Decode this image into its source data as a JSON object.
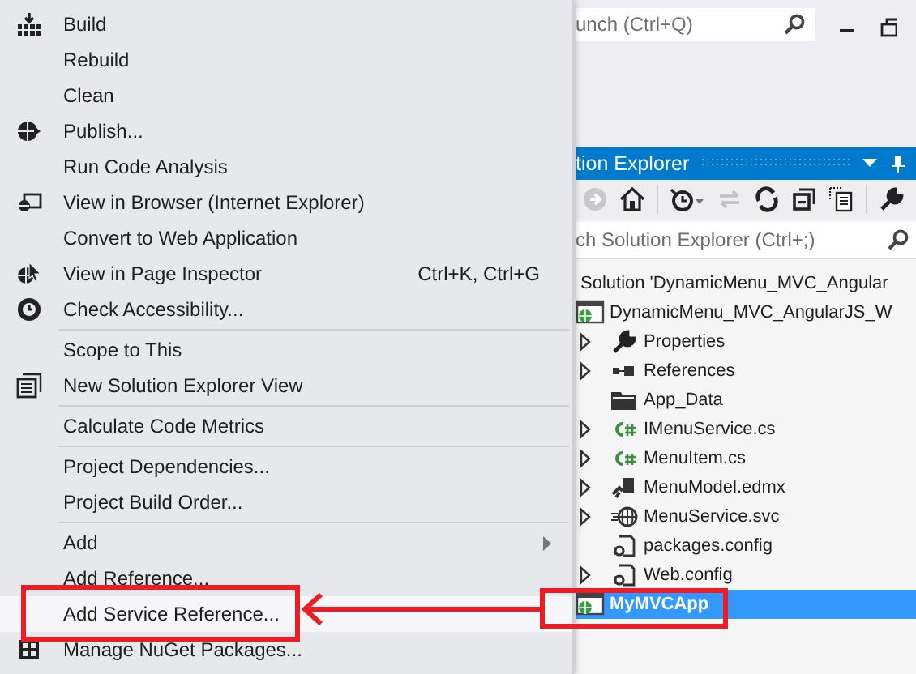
{
  "quick_launch": {
    "value": "unch (Ctrl+Q)"
  },
  "solution_explorer": {
    "title": "tion Explorer",
    "search": {
      "placeholder": "ch Solution Explorer (Ctrl+;)"
    },
    "tree": [
      {
        "label": "Solution 'DynamicMenu_MVC_Angular",
        "selected": false,
        "children": [
          {
            "label": "DynamicMenu_MVC_AngularJS_W",
            "kind": "project",
            "selected": false,
            "children": [
              {
                "label": "Properties",
                "kind": "wrench",
                "expandable": true,
                "selected": false
              },
              {
                "label": "References",
                "kind": "references",
                "expandable": true,
                "selected": false
              },
              {
                "label": "App_Data",
                "kind": "folder",
                "expandable": false,
                "selected": false
              },
              {
                "label": "IMenuService.cs",
                "kind": "csharp",
                "expandable": true,
                "selected": false
              },
              {
                "label": "MenuItem.cs",
                "kind": "csharp",
                "expandable": true,
                "selected": false
              },
              {
                "label": "MenuModel.edmx",
                "kind": "model",
                "expandable": true,
                "selected": false
              },
              {
                "label": "MenuService.svc",
                "kind": "service",
                "expandable": true,
                "selected": false
              },
              {
                "label": "packages.config",
                "kind": "config",
                "expandable": false,
                "selected": false
              },
              {
                "label": "Web.config",
                "kind": "config",
                "expandable": true,
                "selected": false
              }
            ]
          },
          {
            "label": "MyMVCApp",
            "kind": "project",
            "selected": true
          }
        ]
      }
    ]
  },
  "context_menu": {
    "groups": [
      [
        {
          "label": "Build",
          "kind": "build",
          "selected": false
        },
        {
          "label": "Rebuild",
          "kind": "plain",
          "selected": false
        },
        {
          "label": "Clean",
          "kind": "plain",
          "selected": false
        },
        {
          "label": "Publish...",
          "kind": "publish",
          "selected": false
        },
        {
          "label": "Run Code Analysis",
          "kind": "plain",
          "selected": false
        },
        {
          "label": "View in Browser (Internet Explorer)",
          "kind": "browser",
          "selected": false
        },
        {
          "label": "Convert to Web Application",
          "kind": "plain",
          "selected": false
        },
        {
          "label": "View in Page Inspector",
          "kind": "inspector",
          "shortcut": "Ctrl+K, Ctrl+G",
          "selected": false
        },
        {
          "label": "Check Accessibility...",
          "kind": "accessibility",
          "selected": false
        }
      ],
      [
        {
          "label": "Scope to This",
          "kind": "plain",
          "selected": false
        },
        {
          "label": "New Solution Explorer View",
          "kind": "view",
          "selected": false
        }
      ],
      [
        {
          "label": "Calculate Code Metrics",
          "kind": "plain",
          "selected": false
        }
      ],
      [
        {
          "label": "Project Dependencies...",
          "kind": "plain",
          "selected": false
        },
        {
          "label": "Project Build Order...",
          "kind": "plain",
          "selected": false
        }
      ],
      [
        {
          "label": "Add",
          "kind": "plain",
          "submenu": true,
          "selected": false
        },
        {
          "label": "Add Reference...",
          "kind": "plain",
          "selected": false
        },
        {
          "label": "Add Service Reference...",
          "kind": "plain",
          "selected": true
        },
        {
          "label": "Manage NuGet Packages...",
          "kind": "nuget",
          "selected": false
        }
      ]
    ]
  }
}
